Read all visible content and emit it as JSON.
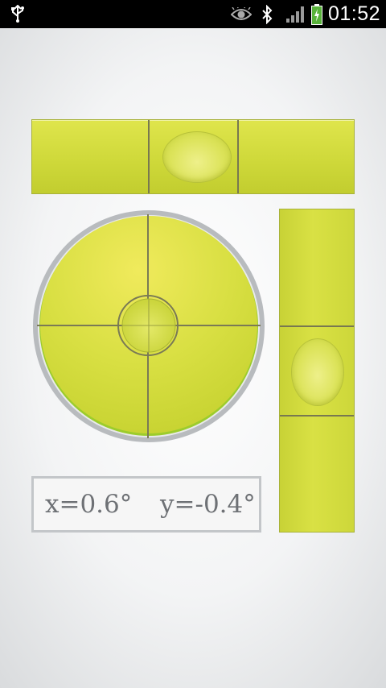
{
  "status_bar": {
    "time": "01:52",
    "icons": [
      "usb-icon",
      "eye-icon",
      "bluetooth-icon",
      "signal-icon",
      "battery-charging-icon"
    ]
  },
  "readout": {
    "x_text": "x=0.6°",
    "y_text": "y=-0.4°"
  },
  "level": {
    "x_degrees": 0.6,
    "y_degrees": -0.4
  },
  "colors": {
    "tube_green": "#d4dc3e",
    "crosshair": "#7a7a55",
    "frame_gray": "#b9bcbf",
    "status_bar": "#000000"
  }
}
